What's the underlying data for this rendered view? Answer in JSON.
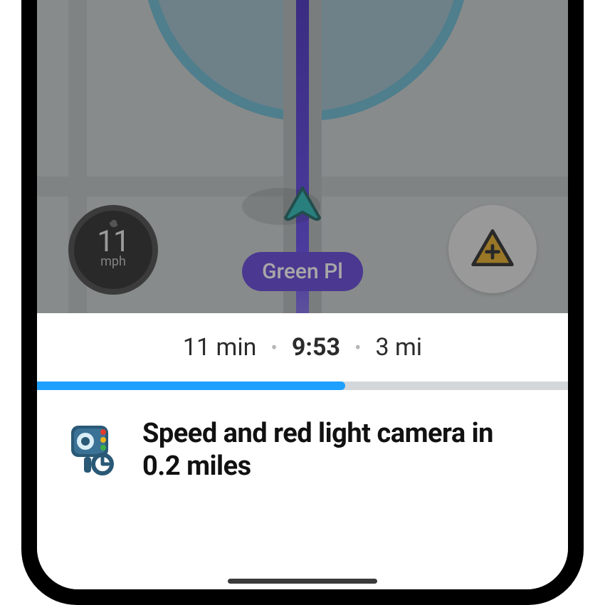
{
  "speed": {
    "value": "11",
    "unit": "mph"
  },
  "street": "Green Pl",
  "eta": {
    "duration": "11 min",
    "arrival": "9:53",
    "distance": "3 mi"
  },
  "progress_percent": 58,
  "alert": {
    "text": "Speed and red light camera in 0.2 miles"
  },
  "colors": {
    "route": "#5635d8",
    "progress": "#1ea0ff",
    "hazard_fill": "#e5a817",
    "hazard_stroke": "#1a1a1a",
    "car_fill": "#18b7b4"
  }
}
